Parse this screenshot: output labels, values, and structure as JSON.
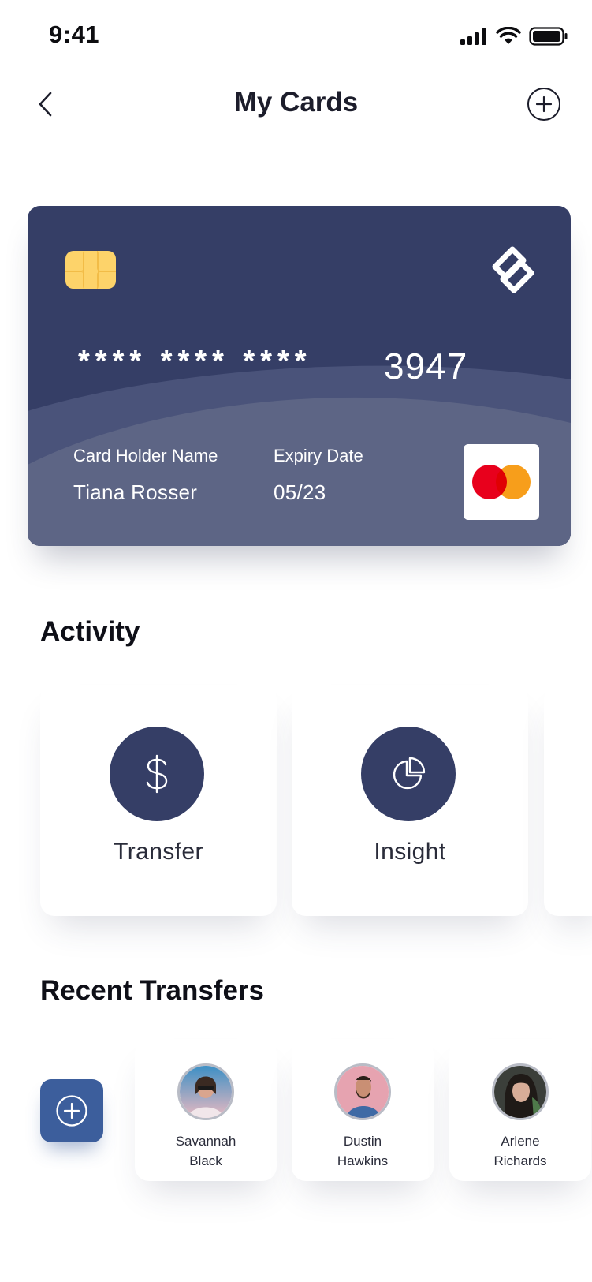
{
  "status_bar": {
    "time": "9:41"
  },
  "header": {
    "title": "My Cards"
  },
  "card": {
    "masked_groups": "**** **** ****",
    "last4": "3947",
    "holder_label": "Card Holder Name",
    "holder_name": "Tiana Rosser",
    "expiry_label": "Expiry Date",
    "expiry": "05/23",
    "network": "mastercard",
    "colors": {
      "card": "#353e66",
      "chip": "#fdd36a",
      "mc_red": "#e8001c",
      "mc_orange": "#f79e1b"
    }
  },
  "activity": {
    "title": "Activity",
    "items": [
      {
        "label": "Transfer",
        "icon": "dollar-icon"
      },
      {
        "label": "Insight",
        "icon": "pie-chart-icon"
      }
    ]
  },
  "recent_transfers": {
    "title": "Recent Transfers",
    "contacts": [
      {
        "first": "Savannah",
        "last": "Black"
      },
      {
        "first": "Dustin",
        "last": "Hawkins"
      },
      {
        "first": "Arlene",
        "last": "Richards"
      }
    ]
  },
  "colors": {
    "accent": "#353e66",
    "button": "#3c5e9c"
  }
}
